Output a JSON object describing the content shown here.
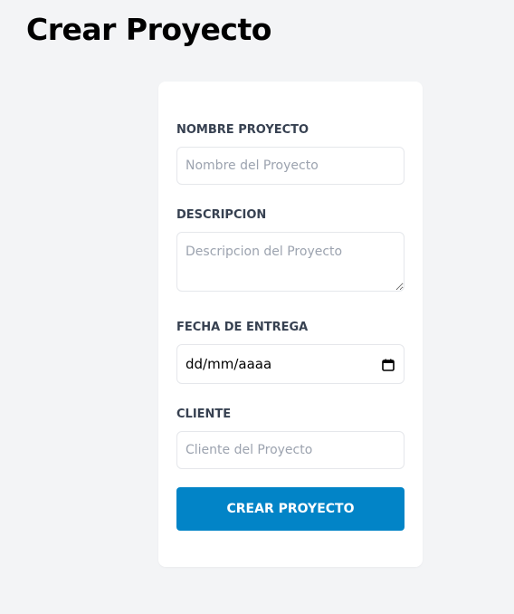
{
  "page": {
    "title": "Crear Proyecto"
  },
  "form": {
    "nombre": {
      "label": "NOMBRE PROYECTO",
      "placeholder": "Nombre del Proyecto",
      "value": ""
    },
    "descripcion": {
      "label": "DESCRIPCION",
      "placeholder": "Descripcion del Proyecto",
      "value": ""
    },
    "fecha": {
      "label": "FECHA DE ENTREGA",
      "display": "dd/mm/aaaa",
      "icon": "calendar-icon"
    },
    "cliente": {
      "label": "CLIENTE",
      "placeholder": "Cliente del Proyecto",
      "value": ""
    },
    "submit_label": "CREAR PROYECTO"
  },
  "colors": {
    "background": "#f3f4f6",
    "card": "#ffffff",
    "label": "#374151",
    "placeholder": "#9ca3af",
    "button": "#0284c7",
    "button_text": "#ffffff"
  }
}
